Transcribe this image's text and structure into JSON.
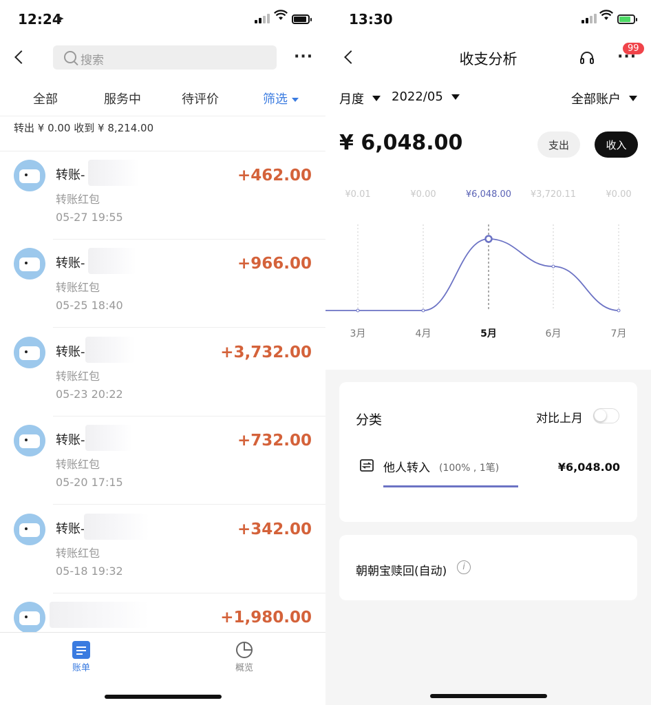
{
  "left": {
    "status": {
      "time": "12:24"
    },
    "header": {
      "search_placeholder": "搜索"
    },
    "tabs": [
      {
        "label": "全部",
        "active": false
      },
      {
        "label": "服务中",
        "active": false
      },
      {
        "label": "待评价",
        "active": false
      },
      {
        "label": "筛选",
        "active": true
      }
    ],
    "summary": "转出 ¥ 0.00   收到 ¥ 8,214.00",
    "transactions": [
      {
        "title": "转账-",
        "sub": "转账红包",
        "time": "05-27  19:55",
        "amount": "+462.00"
      },
      {
        "title": "转账-",
        "sub": "转账红包",
        "time": "05-25  18:40",
        "amount": "+966.00"
      },
      {
        "title": "转账-",
        "sub": "转账红包",
        "time": "05-23  20:22",
        "amount": "+3,732.00"
      },
      {
        "title": "转账-",
        "sub": "转账红包",
        "time": "05-20  17:15",
        "amount": "+732.00"
      },
      {
        "title": "转账-",
        "sub": "转账红包",
        "time": "05-18  19:32",
        "amount": "+342.00"
      },
      {
        "title": "",
        "sub": "",
        "time": "",
        "amount": "+1,980.00"
      }
    ],
    "bottom_nav": [
      {
        "label": "账单",
        "icon": "bill-icon",
        "active": true
      },
      {
        "label": "概览",
        "icon": "pie-chart-icon",
        "active": false
      }
    ]
  },
  "right": {
    "status": {
      "time": "13:30"
    },
    "header": {
      "title": "收支分析",
      "badge": "99"
    },
    "filters": {
      "period": "月度",
      "month": "2022/05",
      "account": "全部账户"
    },
    "total": "¥ 6,048.00",
    "buttons": {
      "expense": "支出",
      "income": "收入"
    },
    "category_card": {
      "title": "分类",
      "compare_label": "对比上月",
      "compare_on": false,
      "item_name": "他人转入",
      "item_meta": "(100% , 1笔)",
      "item_amount": "¥6,048.00",
      "item_share": 1.0
    },
    "card2": {
      "label": "朝朝宝赎回(自动)",
      "info_icon": "info-icon"
    }
  },
  "chart_data": {
    "type": "line",
    "categories": [
      "3月",
      "4月",
      "5月",
      "6月",
      "7月"
    ],
    "value_labels": [
      "¥0.01",
      "¥0.00",
      "¥6,048.00",
      "¥3,720.11",
      "¥0.00"
    ],
    "values": [
      0.01,
      0.0,
      6048.0,
      3720.11,
      0.0
    ],
    "selected_index": 2,
    "ylim": [
      0,
      6048
    ],
    "grid": "vertical-dashed"
  }
}
